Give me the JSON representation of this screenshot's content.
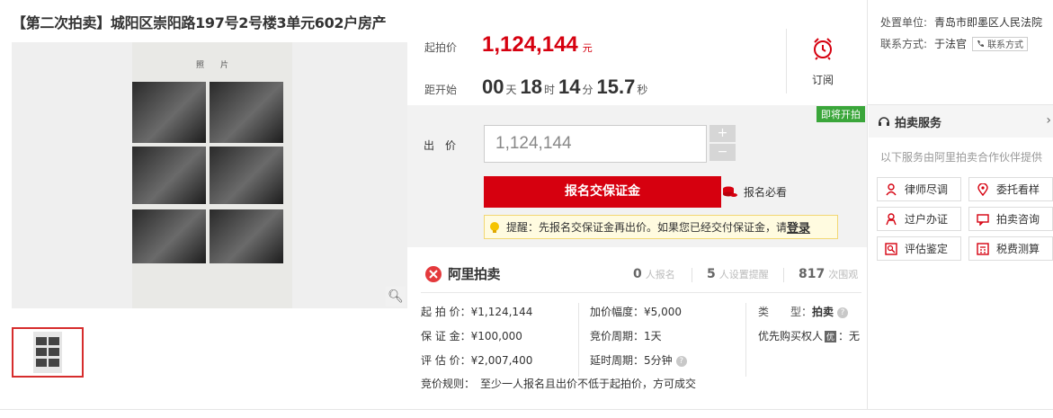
{
  "title": "【第二次拍卖】城阳区崇阳路197号2号楼3单元602户房产",
  "gallery": {
    "sheet_label": "照　　片",
    "zoom_icon": "magnifier-icon"
  },
  "price": {
    "label": "起拍价",
    "value": "1,124,144",
    "unit": "元"
  },
  "countdown": {
    "label": "距开始",
    "days": "00",
    "days_unit": "天",
    "hours": "18",
    "hours_unit": "时",
    "minutes": "14",
    "minutes_unit": "分",
    "seconds": "15.7",
    "seconds_unit": "秒"
  },
  "subscribe": {
    "label": "订阅",
    "icon": "alarm-clock-icon"
  },
  "bid": {
    "status_tag": "即将开拍",
    "label": "出　价",
    "value": "1,124,144",
    "plus": "+",
    "minus": "−",
    "signup_button": "报名交保证金",
    "must_read": "报名必看",
    "notice_text": "提醒：先报名交保证金再出价。如果您已经交付保证金，请",
    "notice_login": "登录"
  },
  "brand": {
    "name": "阿里拍卖"
  },
  "stats": [
    {
      "num": "0",
      "label": "人报名"
    },
    {
      "num": "5",
      "label": "人设置提醒"
    },
    {
      "num": "817",
      "label": "次围观"
    }
  ],
  "details": {
    "start_price": "起 拍 价：¥1,124,144",
    "deposit": "保 证 金：¥100,000",
    "appraisal": "评 估 价：¥2,007,400",
    "increment": "加价幅度：¥5,000",
    "cycle": "竞价周期：1天",
    "delay": "延时周期：5分钟",
    "type_key": "类　　型：",
    "type_value": "拍卖",
    "priority_key": "优先购买权人",
    "priority_badge": "优",
    "priority_value": "：无",
    "rules": "竞价规则：　至少一人报名且出价不低于起拍价，方可成交",
    "help_icon": "?"
  },
  "sidebar": {
    "unit_key": "处置单位:",
    "unit_value": "青岛市即墨区人民法院",
    "contact_key": "联系方式:",
    "contact_value": "于法官",
    "contact_button": "联系方式",
    "service_title": "拍卖服务",
    "service_arrow": "›",
    "service_desc": "以下服务由阿里拍卖合作伙伴提供",
    "services": [
      "律师尽调",
      "委托看样",
      "过户办证",
      "拍卖咨询",
      "评估鉴定",
      "税费测算"
    ]
  },
  "colors": {
    "accent": "#d6000f",
    "green": "#3aa63a"
  }
}
